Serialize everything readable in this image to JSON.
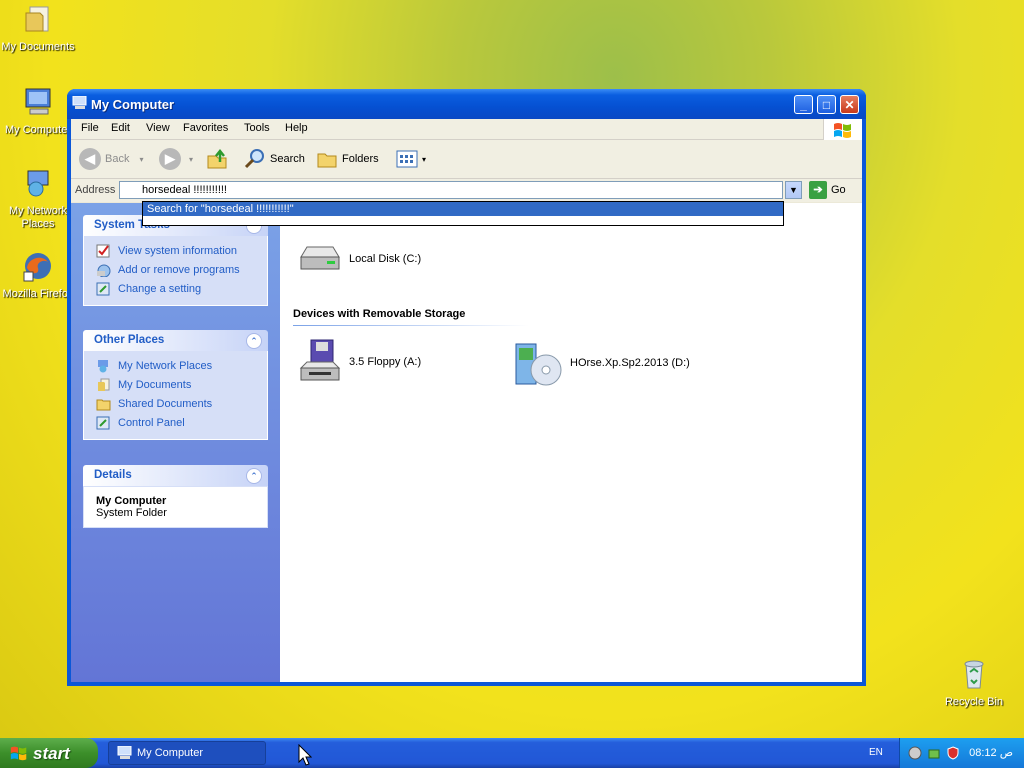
{
  "desktop": {
    "icons": [
      {
        "label": "My Documents"
      },
      {
        "label": "My Computer"
      },
      {
        "label_line1": "My Network",
        "label_line2": "Places"
      },
      {
        "label": "Mozilla Firefox"
      },
      {
        "label": "Recycle Bin"
      }
    ]
  },
  "window": {
    "title": "My Computer",
    "menu": [
      "File",
      "Edit",
      "View",
      "Favorites",
      "Tools",
      "Help"
    ],
    "toolbar": {
      "back": "Back",
      "search": "Search",
      "folders": "Folders"
    },
    "address": {
      "label": "Address",
      "value": "horsedeal !!!!!!!!!!!",
      "suggestion": "Search for \"horsedeal !!!!!!!!!!!\"",
      "go": "Go"
    }
  },
  "left_pane": {
    "system_tasks": {
      "title": "System Tasks",
      "items": [
        "View system information",
        "Add or remove programs",
        "Change a setting"
      ]
    },
    "other_places": {
      "title": "Other Places",
      "items": [
        "My Network Places",
        "My Documents",
        "Shared Documents",
        "Control Panel"
      ]
    },
    "details": {
      "title": "Details",
      "name": "My Computer",
      "type": "System Folder"
    }
  },
  "right_pane": {
    "hard_disk": "Local Disk (C:)",
    "removable_header": "Devices with Removable Storage",
    "floppy": "3.5 Floppy (A:)",
    "cd": "HOrse.Xp.Sp2.2013 (D:)"
  },
  "taskbar": {
    "start": "start",
    "task": "My Computer",
    "language": "EN",
    "clock": "08:12 ص"
  },
  "colors": {
    "title_blue": "#0550d2",
    "link_blue": "#215dc6",
    "start_green": "#3c8f2a",
    "selection": "#316ac5"
  }
}
